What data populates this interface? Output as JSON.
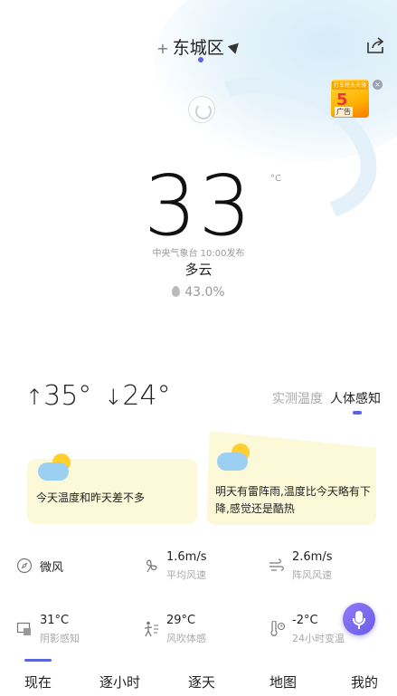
{
  "header": {
    "add_symbol": "+",
    "location": "东城区",
    "share_icon": "share-icon"
  },
  "ad": {
    "top_text": "打车特天天领",
    "number": "5",
    "tag": "广告"
  },
  "current": {
    "temperature": "33",
    "unit": "°C",
    "publish_time": "中央气象台 10:00发布",
    "condition": "多云",
    "humidity": "43.0%"
  },
  "range": {
    "high_arrow": "↑",
    "high": "35°",
    "low_arrow": "↓",
    "low": "24°"
  },
  "mode_tabs": [
    {
      "label": "实测温度",
      "active": false
    },
    {
      "label": "人体感知",
      "active": true
    }
  ],
  "cards": [
    {
      "text": "今天温度和昨天差不多"
    },
    {
      "text": "明天有雷阵雨,温度比今天略有下降,感觉还是酷热"
    }
  ],
  "details": [
    {
      "value": "微风",
      "label": "",
      "icon": "compass-icon"
    },
    {
      "value": "1.6m/s",
      "label": "平均风速",
      "icon": "wind-fan-icon"
    },
    {
      "value": "2.6m/s",
      "label": "阵风风速",
      "icon": "gust-icon"
    },
    {
      "value": "31°C",
      "label": "阴影感知",
      "icon": "shade-icon"
    },
    {
      "value": "29°C",
      "label": "风吹体感",
      "icon": "person-wind-icon"
    },
    {
      "value": "-2°C",
      "label": "24小时变温",
      "icon": "thermometer-clock-icon"
    }
  ],
  "bottom_nav": [
    {
      "label": "现在",
      "active": true
    },
    {
      "label": "逐小时",
      "active": false
    },
    {
      "label": "逐天",
      "active": false
    },
    {
      "label": "地图",
      "active": false
    },
    {
      "label": "我的",
      "active": false
    }
  ],
  "colors": {
    "accent": "#5b63e0",
    "card_bg": "#fcf9d9",
    "voice": "#7a68f0"
  }
}
